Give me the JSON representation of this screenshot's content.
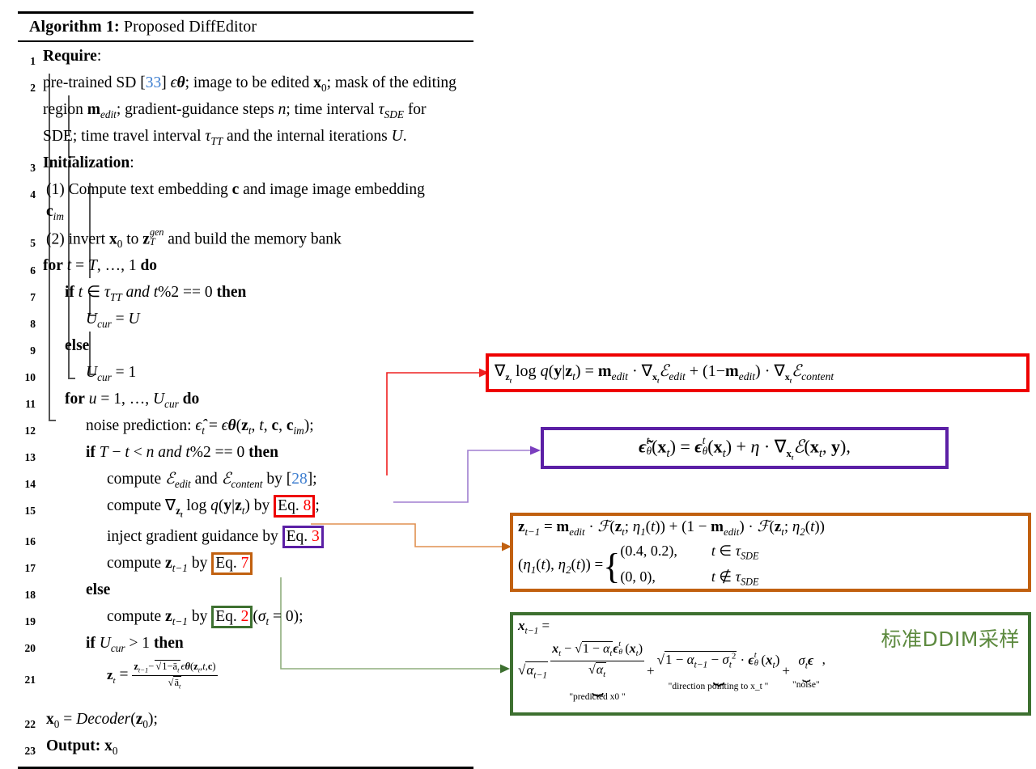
{
  "algorithm": {
    "title_bold": "Algorithm 1:",
    "title_rest": " Proposed DiffEditor",
    "lines": [
      {
        "n": "1",
        "text": "Require:"
      },
      {
        "n": "2",
        "text": "pre-trained SD [33] ϵθ; image to be edited x0; mask of the editing region m_edit; gradient-guidance steps n; time interval τSDE for SDE; time travel interval τTT and the internal iterations U."
      },
      {
        "n": "3",
        "text": "Initialization:"
      },
      {
        "n": "4",
        "text": "(1) Compute text embedding c and image image embedding c_im"
      },
      {
        "n": "5",
        "text": "(2) invert x0 to z_T^gen and build the memory bank"
      },
      {
        "n": "6",
        "text": "for t = T, …, 1 do"
      },
      {
        "n": "7",
        "text": "if t ∈ τTT and t%2 == 0 then"
      },
      {
        "n": "8",
        "text": "U_cur = U"
      },
      {
        "n": "9",
        "text": "else"
      },
      {
        "n": "10",
        "text": "U_cur = 1"
      },
      {
        "n": "11",
        "text": "for u = 1, …, U_cur do"
      },
      {
        "n": "12",
        "text": "noise prediction: ϵ̂_t = ϵθ(z_t, t, c, c_im);"
      },
      {
        "n": "13",
        "text": "if T − t < n and t%2 == 0 then"
      },
      {
        "n": "14",
        "text": "compute E_edit and E_content by [28];"
      },
      {
        "n": "15",
        "text": "compute ∇z_t log q(y|z_t) by Eq. 8;"
      },
      {
        "n": "16",
        "text": "inject gradient guidance by Eq. 3"
      },
      {
        "n": "17",
        "text": "compute z_{t−1} by Eq. 7"
      },
      {
        "n": "18",
        "text": "else"
      },
      {
        "n": "19",
        "text": "compute z_{t−1} by Eq. 2 (σ_t = 0);"
      },
      {
        "n": "20",
        "text": "if U_cur > 1 then"
      },
      {
        "n": "21",
        "text": "z_t = (z_{t−1} − √(1−ᾱ_t) ϵθ(z_t,t,c)) / √ᾱ_t"
      },
      {
        "n": "22",
        "text": "x0 = Decoder(z0);"
      },
      {
        "n": "23",
        "text": "Output: x0"
      }
    ],
    "citation_33": "33",
    "citation_28": "28",
    "eq_label": "Eq.",
    "eq_numbers": {
      "red": "8",
      "purple": "3",
      "orange": "7",
      "green": "2"
    }
  },
  "panels": {
    "red": {
      "name": "gradient-guidance-equation",
      "color": "#ee0000",
      "equation": "∇z_t log q(y|z_t) = m_edit · ∇x_t E_edit + (1 − m_edit) · ∇x_t E_content"
    },
    "purple": {
      "name": "noise-injection-equation",
      "color": "#5b1fa5",
      "equation": "ẽθ^t(x_t) = ϵθ^t(x_t) + η · ∇x_t E(x_t, y),"
    },
    "orange": {
      "name": "sde-blend-equation",
      "color": "#c1600f",
      "equation_line1": "z_{t−1} = m_edit · F(z_t; η1(t)) + (1 − m_edit) · F(z_t; η2(t))",
      "equation_line2_lhs": "(η1(t), η2(t)) =",
      "case1_value": "(0.4, 0.2),",
      "case1_cond": "t ∈ τSDE",
      "case2_value": "(0, 0),",
      "case2_cond": "t ∉ τSDE"
    },
    "green": {
      "name": "ddim-sampling-equation",
      "color": "#3d7030",
      "annotation_cn": "标准DDIM采样",
      "lhs": "x_{t−1} =",
      "brace_label_1": "\"predicted x0 \"",
      "brace_label_2": "\"direction pointing to x_t \"",
      "brace_label_3": "\"noise\""
    }
  }
}
